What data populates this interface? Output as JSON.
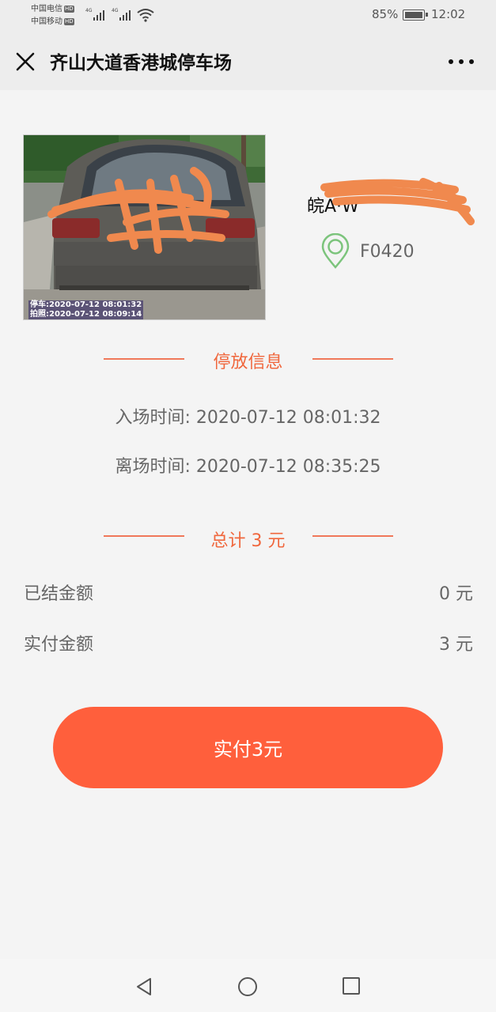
{
  "status_bar": {
    "carrier_1": "中国电信",
    "carrier_2": "中国移动",
    "hd": "HD",
    "network": "4G",
    "battery_text": "85%",
    "time": "12:02"
  },
  "navbar": {
    "title": "齐山大道香港城停车场",
    "close_icon": "close-icon",
    "more_icon": "more-dots-icon"
  },
  "vehicle": {
    "photo_stamp_1": "停车:2020-07-12 08:01:32",
    "photo_stamp_2": "拍照:2020-07-12 08:09:14",
    "plate_text": "皖A·W",
    "lot_code": "F0420"
  },
  "parking_info": {
    "section_title": "停放信息",
    "entry_time": "入场时间: 2020-07-12 08:01:32",
    "exit_time": "离场时间: 2020-07-12 08:35:25"
  },
  "fees": {
    "total_title": "总计 3 元",
    "settled_label": "已结金额",
    "settled_value": "0 元",
    "paid_label": "实付金额",
    "paid_value": "3 元"
  },
  "pay_button": {
    "label": "实付3元"
  },
  "colors": {
    "accent": "#f0673d",
    "button": "#ff5f3c",
    "pin": "#7cc47c"
  }
}
